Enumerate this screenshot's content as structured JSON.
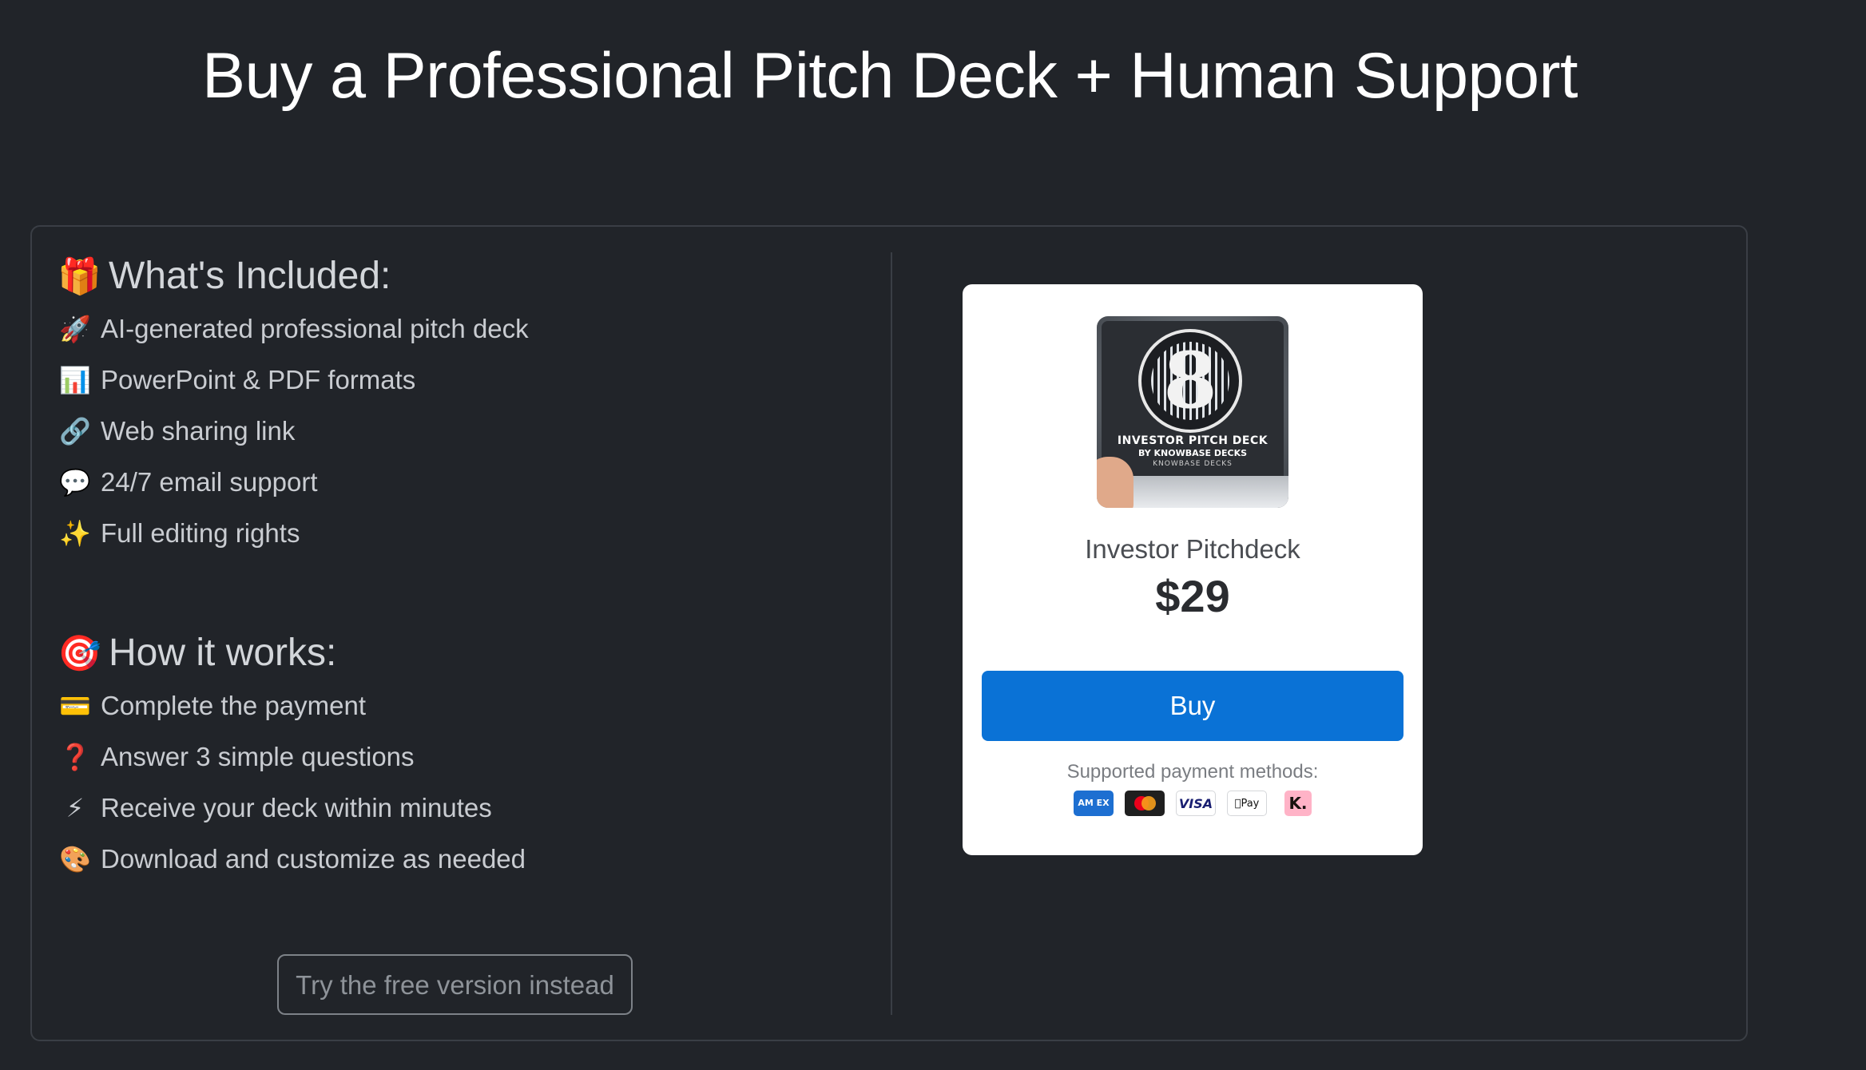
{
  "page": {
    "title": "Buy a Professional Pitch Deck + Human Support"
  },
  "included": {
    "heading_emoji": "🎁",
    "heading": "What's Included:",
    "items": [
      {
        "emoji": "🚀",
        "text": "AI-generated professional pitch deck"
      },
      {
        "emoji": "📊",
        "text": "PowerPoint & PDF formats"
      },
      {
        "emoji": "🔗",
        "text": "Web sharing link"
      },
      {
        "emoji": "💬",
        "text": "24/7 email support"
      },
      {
        "emoji": "✨",
        "text": "Full editing rights"
      }
    ]
  },
  "how_it_works": {
    "heading_emoji": "🎯",
    "heading": "How it works:",
    "items": [
      {
        "emoji": "💳",
        "text": "Complete the payment"
      },
      {
        "emoji": "❓",
        "text": "Answer 3 simple questions"
      },
      {
        "emoji": "⚡",
        "text": "Receive your deck within minutes"
      },
      {
        "emoji": "🎨",
        "text": "Download and customize as needed"
      }
    ]
  },
  "free_version_button": "Try the free version instead",
  "product": {
    "image_text": {
      "line1": "INVESTOR PITCH DECK",
      "line2": "BY KNOWBASE DECKS",
      "line3": "KNOWBASE DECKS"
    },
    "name": "Investor Pitchdeck",
    "price": "$29",
    "buy_label": "Buy",
    "payment_label": "Supported payment methods:",
    "payment_methods": [
      {
        "name": "amex-icon",
        "label": "AM EX"
      },
      {
        "name": "mastercard-icon",
        "label": ""
      },
      {
        "name": "visa-icon",
        "label": "VISA"
      },
      {
        "name": "apple-pay-icon",
        "label": "Pay"
      },
      {
        "name": "klarna-icon",
        "label": "K."
      }
    ]
  },
  "colors": {
    "background": "#212429",
    "panel_border": "#3a3e45",
    "buy_button": "#0a72d6",
    "card_background": "#ffffff"
  }
}
